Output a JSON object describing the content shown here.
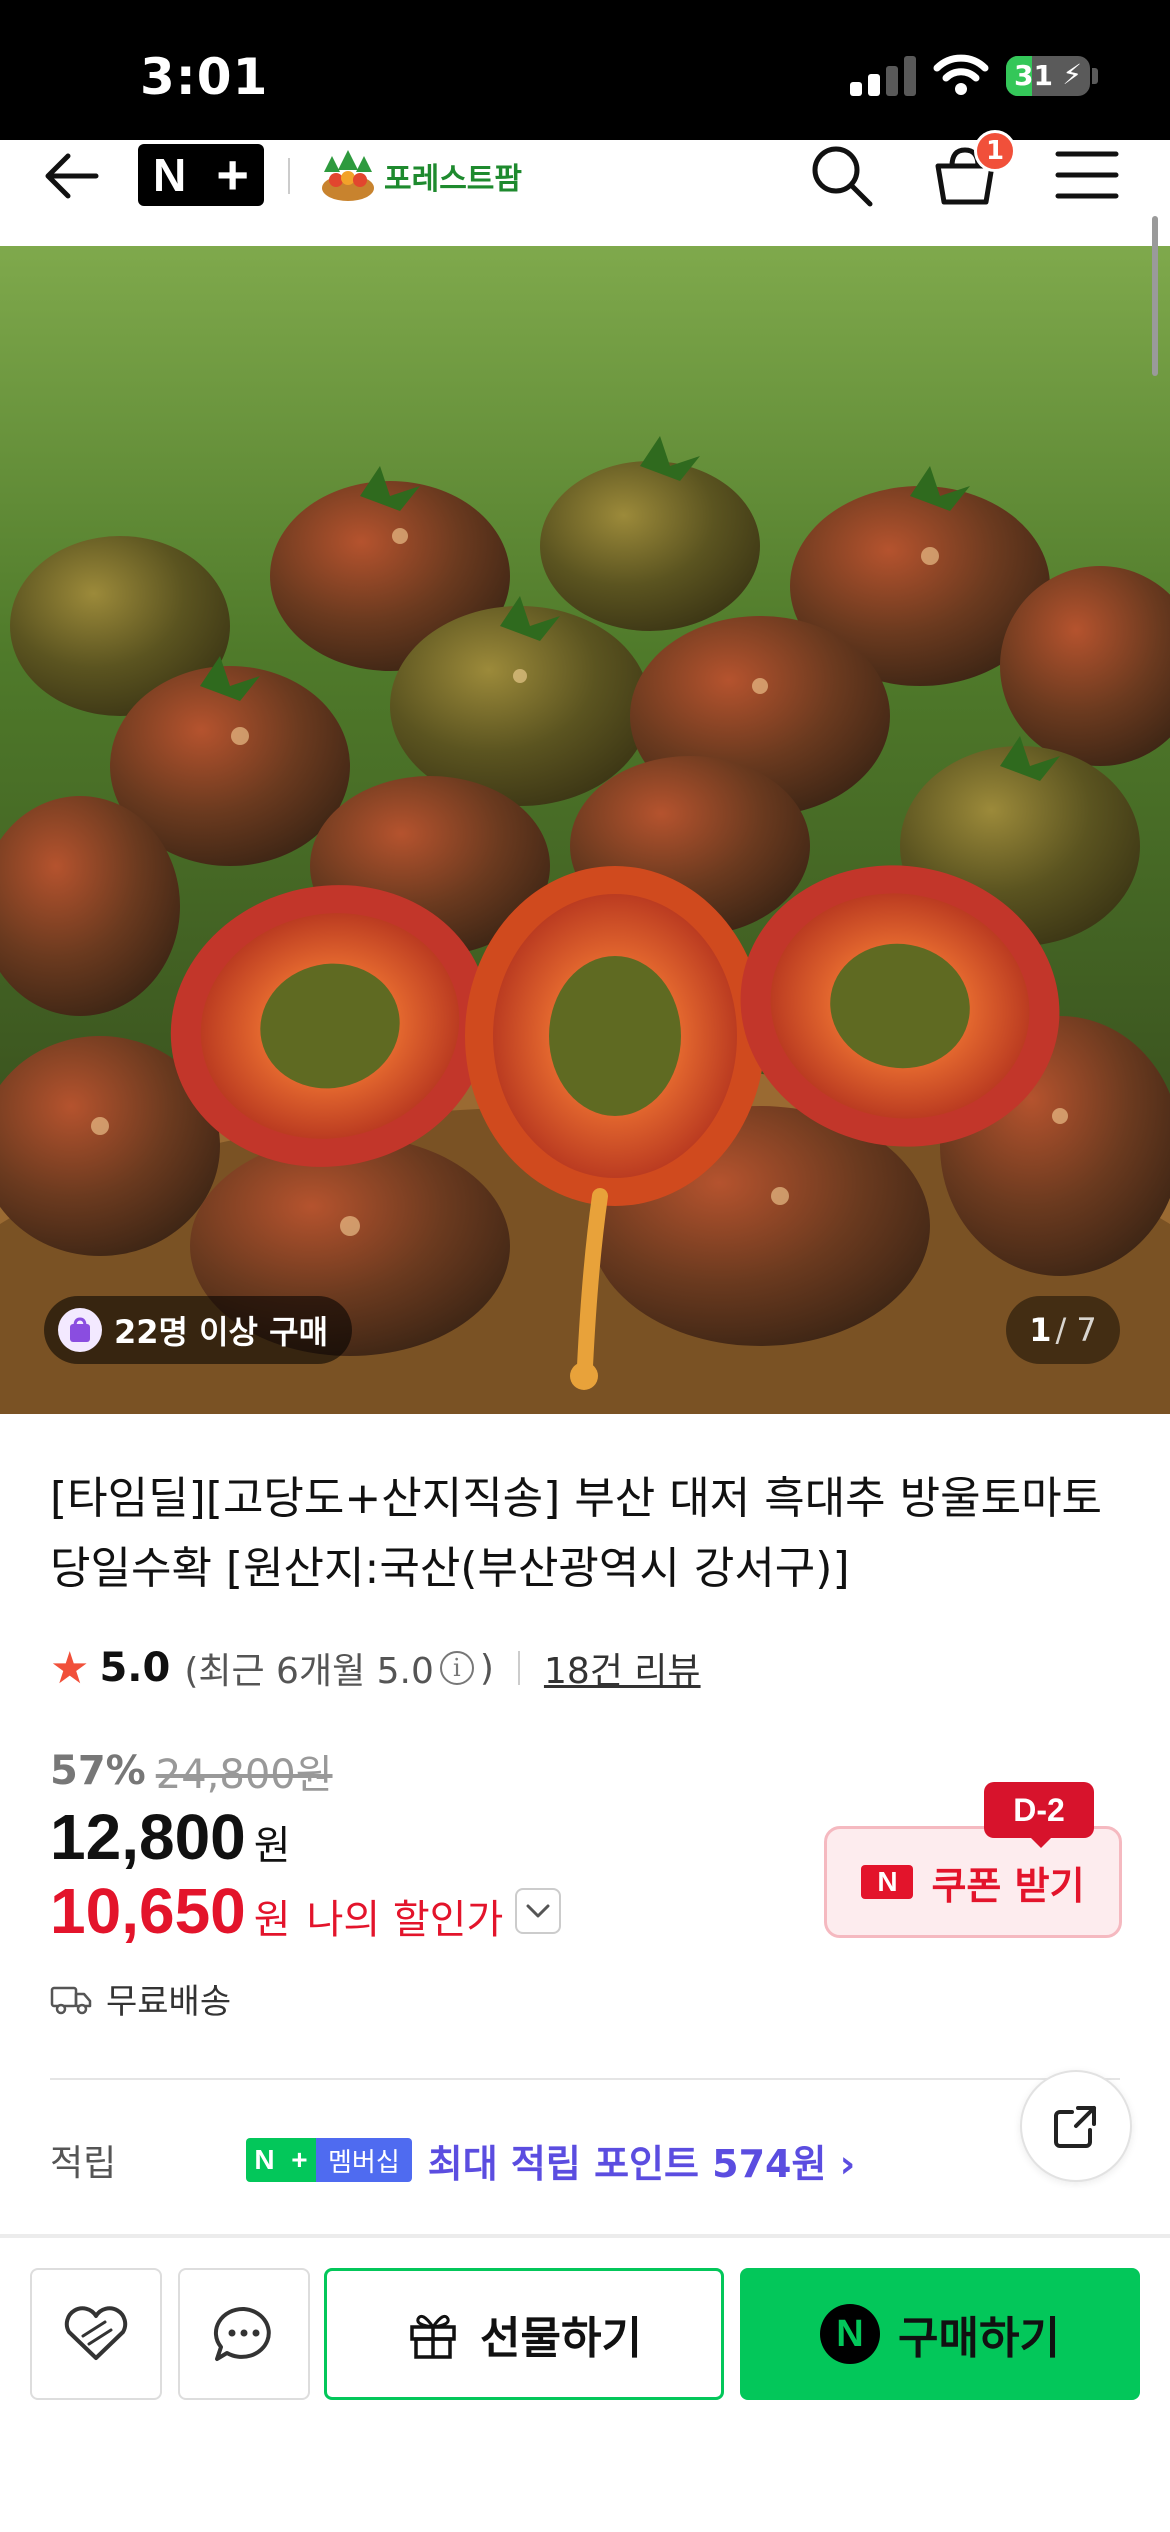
{
  "status_bar": {
    "time": "3:01",
    "battery_level": "31",
    "battery_fraction": 0.31,
    "signal_bars": 2,
    "battery_color": "#34c759"
  },
  "header": {
    "brand_badge": "N",
    "brand_plus": "+",
    "store_name": "포레스트팜",
    "cart_count": "1",
    "icons": [
      "back-arrow-icon",
      "search-icon",
      "cart-icon",
      "menu-icon"
    ]
  },
  "gallery": {
    "buyers_badge": "22명 이상 구매",
    "current_index": "1",
    "total": "/ 7"
  },
  "product": {
    "title": "[타임딜][고당도+산지직송] 부산 대저 흑대추 방울토마토 당일수확 [원산지:국산(부산광역시 강서구)]",
    "rating": "5.0",
    "rating_recent": "(최근 6개월 5.0",
    "rating_close": ")",
    "review_count": "18건 리뷰",
    "discount_percent": "57%",
    "original_price": "24,800원",
    "price": "12,800",
    "price_unit": "원",
    "my_price": "10,650",
    "my_price_unit": "원",
    "my_price_label": "나의 할인가",
    "shipping": "무료배송"
  },
  "coupon": {
    "d_badge": "D-2",
    "logo": "N",
    "label": "쿠폰 받기"
  },
  "points": {
    "label": "적립",
    "np_badge_n": "N",
    "np_badge_plus": "+",
    "np_badge_text": "멤버십",
    "max_text": "최대 적립 포인트 574원 ›"
  },
  "actions": {
    "gift_label": "선물하기",
    "buy_logo": "N",
    "buy_label": "구매하기"
  },
  "colors": {
    "naver_green": "#03c75a",
    "discount_red": "#e3142b",
    "points_purple": "#5b4de0"
  }
}
